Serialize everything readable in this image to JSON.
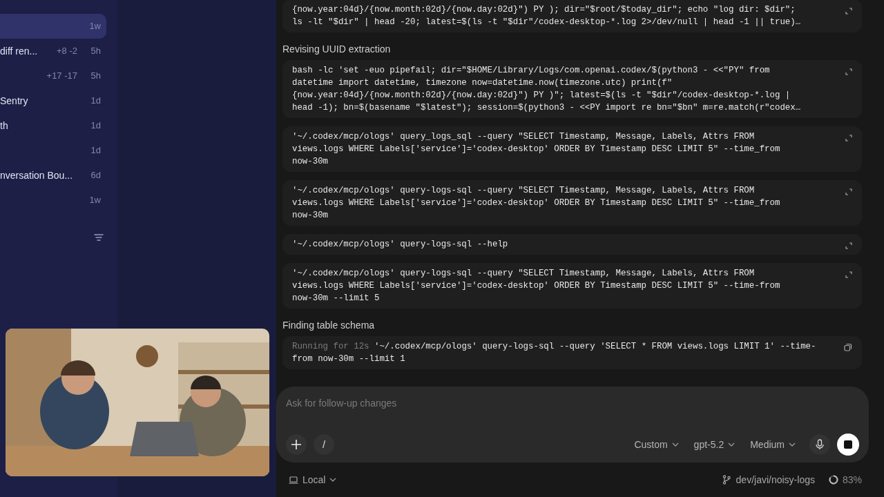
{
  "sidebar": {
    "items": [
      {
        "time": "1w",
        "selected": true
      },
      {
        "title": "diff ren...",
        "diff": "+8 -2",
        "time": "5h",
        "selected": false
      },
      {
        "diff": "+17 -17",
        "time": "5h",
        "selected": false
      },
      {
        "title": "Sentry",
        "time": "1d",
        "selected": false
      },
      {
        "title": "th",
        "time": "1d",
        "selected": false
      },
      {
        "time": "1d",
        "selected": false
      },
      {
        "title": "nversation Bou...",
        "time": "6d",
        "selected": false
      },
      {
        "time": "1w",
        "selected": false
      }
    ]
  },
  "transcript": [
    {
      "kind": "code",
      "text": "{now.year:04d}/{now.month:02d}/{now.day:02d}\") PY ); dir=\"$root/$today_dir\"; echo \"log dir: $dir\";\nls -lt \"$dir\" | head -20; latest=$(ls -t \"$dir\"/codex-desktop-*.log 2>/dev/null | head -1 || true)…"
    },
    {
      "kind": "heading",
      "text": "Revising UUID extraction"
    },
    {
      "kind": "code",
      "text": "bash -lc 'set -euo pipefail; dir=\"$HOME/Library/Logs/com.openai.codex/$(python3 - <<\"PY\" from\ndatetime import datetime, timezone now=datetime.now(timezone.utc) print(f\"\n{now.year:04d}/{now.month:02d}/{now.day:02d}\") PY )\"; latest=$(ls -t \"$dir\"/codex-desktop-*.log |\nhead -1); bn=$(basename \"$latest\"); session=$(python3 - <<PY import re bn=\"$bn\" m=re.match(r\"codex…"
    },
    {
      "kind": "code",
      "text": "'~/.codex/mcp/ologs' query_logs_sql --query \"SELECT Timestamp, Message, Labels, Attrs FROM\nviews.logs WHERE Labels['service']='codex-desktop' ORDER BY Timestamp DESC LIMIT 5\" --time_from\nnow-30m"
    },
    {
      "kind": "code",
      "text": "'~/.codex/mcp/ologs' query-logs-sql --query \"SELECT Timestamp, Message, Labels, Attrs FROM\nviews.logs WHERE Labels['service']='codex-desktop' ORDER BY Timestamp DESC LIMIT 5\" --time_from\nnow-30m"
    },
    {
      "kind": "code",
      "text": "'~/.codex/mcp/ologs' query-logs-sql --help"
    },
    {
      "kind": "code",
      "text": "'~/.codex/mcp/ologs' query-logs-sql --query \"SELECT Timestamp, Message, Labels, Attrs FROM\nviews.logs WHERE Labels['service']='codex-desktop' ORDER BY Timestamp DESC LIMIT 5\" --time-from\nnow-30m --limit 5"
    },
    {
      "kind": "heading",
      "text": "Finding table schema"
    },
    {
      "kind": "running",
      "status": "Running for 12s",
      "text": "'~/.codex/mcp/ologs' query-logs-sql --query 'SELECT * FROM views.logs LIMIT 1' --time-\nfrom now-30m --limit 1"
    }
  ],
  "composer": {
    "placeholder": "Ask for follow-up changes",
    "slash": "/",
    "options": [
      "Custom",
      "gpt-5.2",
      "Medium"
    ]
  },
  "footer": {
    "environment": "Local",
    "branch": "dev/javi/noisy-logs",
    "context": "83%"
  }
}
